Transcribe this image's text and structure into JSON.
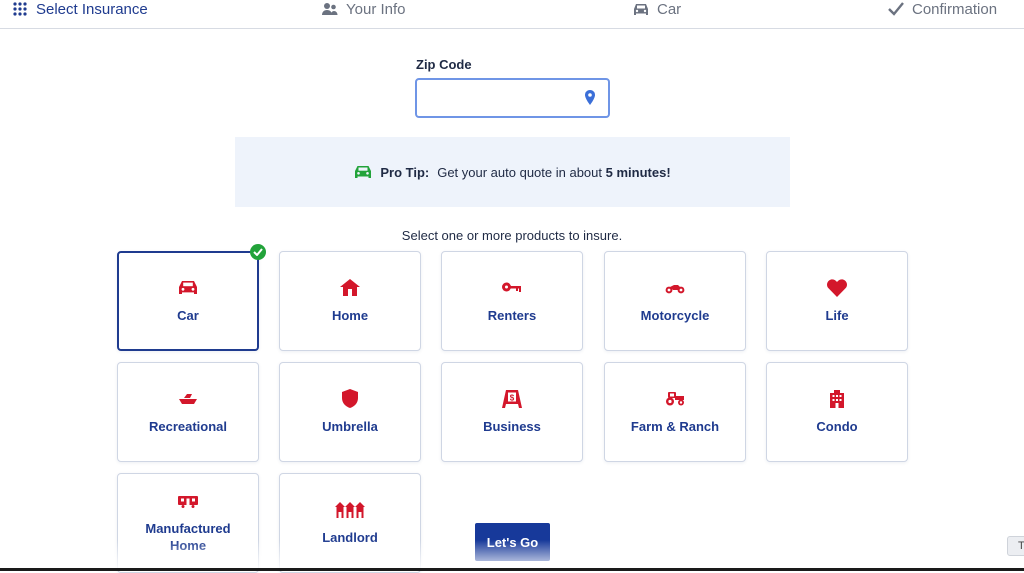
{
  "steps": [
    {
      "label": "Select Insurance",
      "icon": "grid-icon",
      "active": true
    },
    {
      "label": "Your Info",
      "icon": "users-icon",
      "active": false
    },
    {
      "label": "Car",
      "icon": "car-icon",
      "active": false
    },
    {
      "label": "Confirmation",
      "icon": "check-icon",
      "active": false
    }
  ],
  "zip": {
    "label": "Zip Code",
    "value": "",
    "placeholder": "",
    "icon": "location-pin-icon"
  },
  "tip": {
    "prefix": "Pro Tip:",
    "text": "Get your auto quote in about",
    "highlight": "5 minutes!",
    "icon": "car-icon"
  },
  "prompt": "Select one or more products to insure.",
  "products": [
    {
      "label": "Car",
      "icon": "car-icon",
      "selected": true
    },
    {
      "label": "Home",
      "icon": "house-icon",
      "selected": false
    },
    {
      "label": "Renters",
      "icon": "key-icon",
      "selected": false
    },
    {
      "label": "Motorcycle",
      "icon": "motorcycle-icon",
      "selected": false
    },
    {
      "label": "Life",
      "icon": "heart-icon",
      "selected": false
    },
    {
      "label": "Recreational",
      "icon": "boat-icon",
      "selected": false
    },
    {
      "label": "Umbrella",
      "icon": "shield-icon",
      "selected": false
    },
    {
      "label": "Business",
      "icon": "storefront-sign-icon",
      "selected": false
    },
    {
      "label": "Farm & Ranch",
      "icon": "tractor-icon",
      "selected": false
    },
    {
      "label": "Condo",
      "icon": "building-icon",
      "selected": false
    },
    {
      "label": "Manufactured Home",
      "icon": "mobile-home-icon",
      "selected": false
    },
    {
      "label": "Landlord",
      "icon": "houses-icon",
      "selected": false
    }
  ],
  "submit_label": "Let's Go",
  "corner_tab": "T",
  "colors": {
    "brand": "#1f3b8f",
    "accent_red": "#d3172b",
    "success": "#22a33a",
    "tip_bg": "#eef3fb",
    "button": "#17399a"
  }
}
